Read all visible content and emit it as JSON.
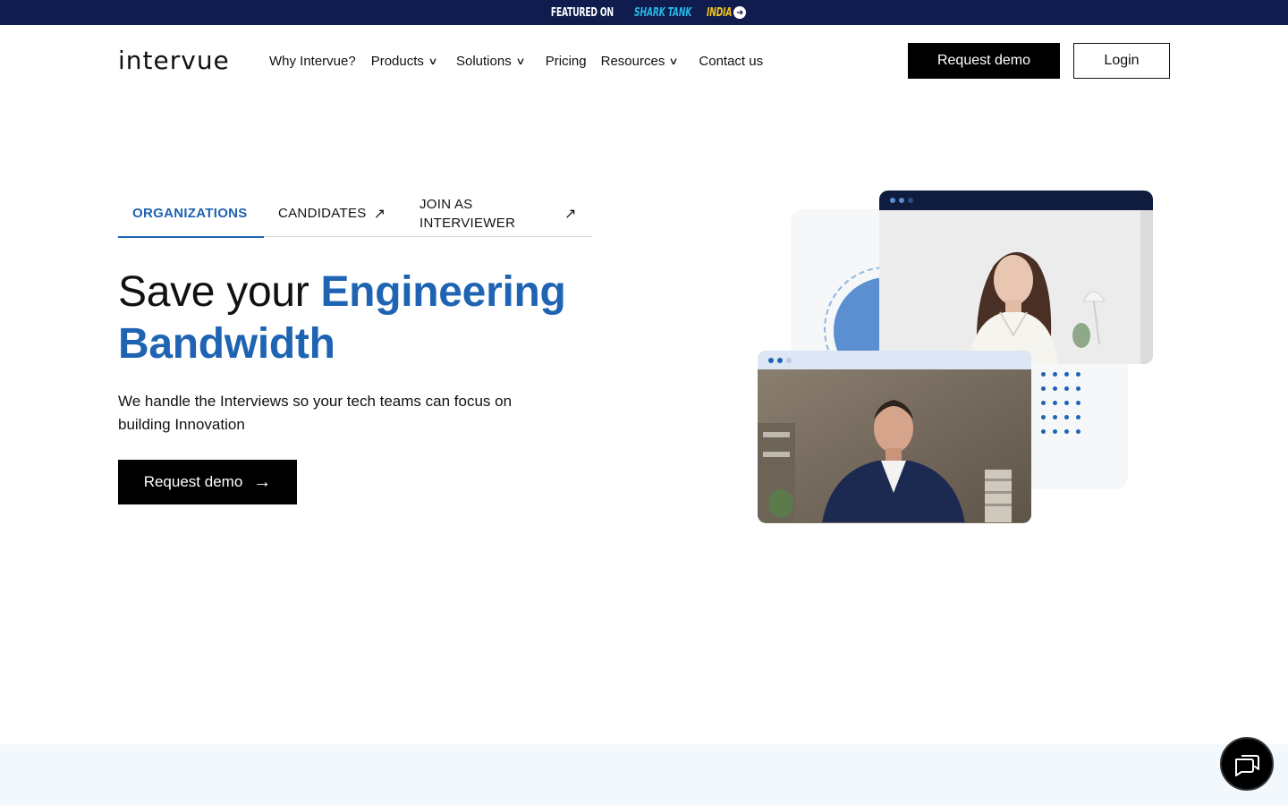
{
  "banner": {
    "prefix": "FEATURED ON",
    "shark": "SHARK TANK",
    "india": "INDIA",
    "arrow_icon": "arrow-right-circle-icon"
  },
  "header": {
    "logo_text": "intervue",
    "nav": [
      {
        "label": "Why Intervue?",
        "has_dropdown": false
      },
      {
        "label": "Products",
        "has_dropdown": true
      },
      {
        "label": "Solutions",
        "has_dropdown": true
      },
      {
        "label": "Pricing",
        "has_dropdown": false
      },
      {
        "label": "Resources",
        "has_dropdown": true
      },
      {
        "label": "Contact us",
        "has_dropdown": false
      }
    ],
    "request_demo_label": "Request demo",
    "login_label": "Login"
  },
  "tabs": [
    {
      "label": "ORGANIZATIONS",
      "active": true
    },
    {
      "label": "CANDIDATES",
      "external": true
    },
    {
      "label": "JOIN AS INTERVIEWER",
      "external": true
    }
  ],
  "hero": {
    "title_plain": "Save your ",
    "title_accent": "Engineering Bandwidth",
    "subtitle": "We handle the Interviews so your tech teams can focus on building Innovation",
    "cta_label": "Request demo"
  },
  "colors": {
    "accent": "#1f63b3",
    "banner_bg": "#0f1c4d",
    "shark_cyan": "#29b6e8",
    "india_yellow": "#f5c518",
    "band_bg": "#f3f8fc"
  },
  "chat": {
    "icon": "chat-bubbles-icon"
  }
}
